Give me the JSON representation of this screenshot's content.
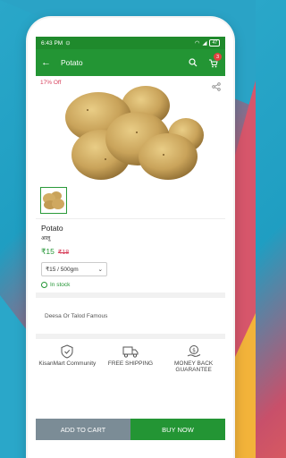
{
  "statusbar": {
    "time": "6:43 PM",
    "battery": "47"
  },
  "appbar": {
    "title": "Potato",
    "cart_count": "3"
  },
  "product": {
    "discount": "17% Off",
    "name": "Potato",
    "name_local": "आलू",
    "price": "₹15",
    "mrp": "₹18",
    "variant": "₹15 / 500gm",
    "stock": "In stock",
    "description": "Deesa Or Talod Famous"
  },
  "features": [
    {
      "label": "KisanMart Community",
      "icon": "shield-check-icon"
    },
    {
      "label": "FREE SHIPPING",
      "icon": "truck-icon"
    },
    {
      "label": "MONEY BACK GUARANTEE",
      "icon": "money-back-icon"
    }
  ],
  "actions": {
    "add_to_cart": "ADD TO CART",
    "buy_now": "BUY NOW"
  },
  "colors": {
    "primary": "#239534",
    "status": "#1f8a2c",
    "discount": "#d7405b",
    "add_to_cart": "#7b8c96"
  }
}
